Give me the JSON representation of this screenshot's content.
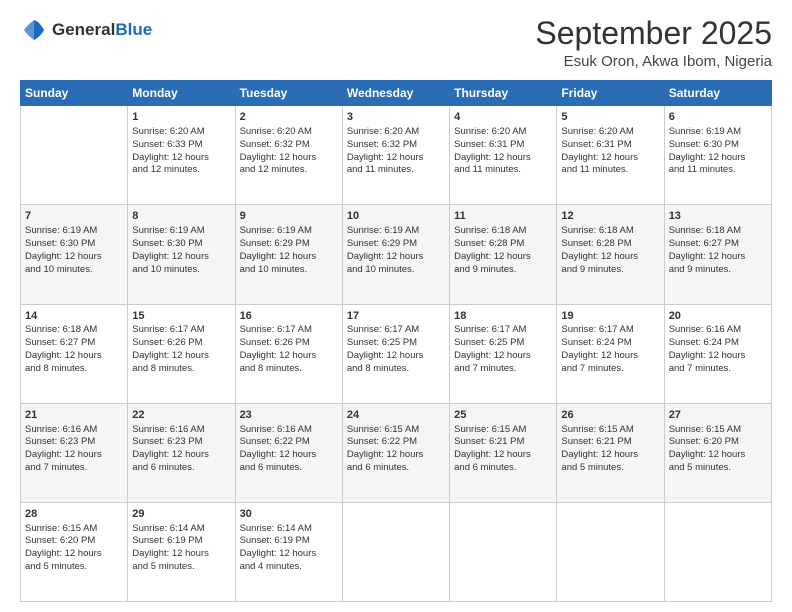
{
  "header": {
    "logo_general": "General",
    "logo_blue": "Blue",
    "month_title": "September 2025",
    "subtitle": "Esuk Oron, Akwa Ibom, Nigeria"
  },
  "days_of_week": [
    "Sunday",
    "Monday",
    "Tuesday",
    "Wednesday",
    "Thursday",
    "Friday",
    "Saturday"
  ],
  "weeks": [
    [
      {
        "day": "",
        "content": ""
      },
      {
        "day": "1",
        "content": "Sunrise: 6:20 AM\nSunset: 6:33 PM\nDaylight: 12 hours\nand 12 minutes."
      },
      {
        "day": "2",
        "content": "Sunrise: 6:20 AM\nSunset: 6:32 PM\nDaylight: 12 hours\nand 12 minutes."
      },
      {
        "day": "3",
        "content": "Sunrise: 6:20 AM\nSunset: 6:32 PM\nDaylight: 12 hours\nand 11 minutes."
      },
      {
        "day": "4",
        "content": "Sunrise: 6:20 AM\nSunset: 6:31 PM\nDaylight: 12 hours\nand 11 minutes."
      },
      {
        "day": "5",
        "content": "Sunrise: 6:20 AM\nSunset: 6:31 PM\nDaylight: 12 hours\nand 11 minutes."
      },
      {
        "day": "6",
        "content": "Sunrise: 6:19 AM\nSunset: 6:30 PM\nDaylight: 12 hours\nand 11 minutes."
      }
    ],
    [
      {
        "day": "7",
        "content": "Sunrise: 6:19 AM\nSunset: 6:30 PM\nDaylight: 12 hours\nand 10 minutes."
      },
      {
        "day": "8",
        "content": "Sunrise: 6:19 AM\nSunset: 6:30 PM\nDaylight: 12 hours\nand 10 minutes."
      },
      {
        "day": "9",
        "content": "Sunrise: 6:19 AM\nSunset: 6:29 PM\nDaylight: 12 hours\nand 10 minutes."
      },
      {
        "day": "10",
        "content": "Sunrise: 6:19 AM\nSunset: 6:29 PM\nDaylight: 12 hours\nand 10 minutes."
      },
      {
        "day": "11",
        "content": "Sunrise: 6:18 AM\nSunset: 6:28 PM\nDaylight: 12 hours\nand 9 minutes."
      },
      {
        "day": "12",
        "content": "Sunrise: 6:18 AM\nSunset: 6:28 PM\nDaylight: 12 hours\nand 9 minutes."
      },
      {
        "day": "13",
        "content": "Sunrise: 6:18 AM\nSunset: 6:27 PM\nDaylight: 12 hours\nand 9 minutes."
      }
    ],
    [
      {
        "day": "14",
        "content": "Sunrise: 6:18 AM\nSunset: 6:27 PM\nDaylight: 12 hours\nand 8 minutes."
      },
      {
        "day": "15",
        "content": "Sunrise: 6:17 AM\nSunset: 6:26 PM\nDaylight: 12 hours\nand 8 minutes."
      },
      {
        "day": "16",
        "content": "Sunrise: 6:17 AM\nSunset: 6:26 PM\nDaylight: 12 hours\nand 8 minutes."
      },
      {
        "day": "17",
        "content": "Sunrise: 6:17 AM\nSunset: 6:25 PM\nDaylight: 12 hours\nand 8 minutes."
      },
      {
        "day": "18",
        "content": "Sunrise: 6:17 AM\nSunset: 6:25 PM\nDaylight: 12 hours\nand 7 minutes."
      },
      {
        "day": "19",
        "content": "Sunrise: 6:17 AM\nSunset: 6:24 PM\nDaylight: 12 hours\nand 7 minutes."
      },
      {
        "day": "20",
        "content": "Sunrise: 6:16 AM\nSunset: 6:24 PM\nDaylight: 12 hours\nand 7 minutes."
      }
    ],
    [
      {
        "day": "21",
        "content": "Sunrise: 6:16 AM\nSunset: 6:23 PM\nDaylight: 12 hours\nand 7 minutes."
      },
      {
        "day": "22",
        "content": "Sunrise: 6:16 AM\nSunset: 6:23 PM\nDaylight: 12 hours\nand 6 minutes."
      },
      {
        "day": "23",
        "content": "Sunrise: 6:16 AM\nSunset: 6:22 PM\nDaylight: 12 hours\nand 6 minutes."
      },
      {
        "day": "24",
        "content": "Sunrise: 6:15 AM\nSunset: 6:22 PM\nDaylight: 12 hours\nand 6 minutes."
      },
      {
        "day": "25",
        "content": "Sunrise: 6:15 AM\nSunset: 6:21 PM\nDaylight: 12 hours\nand 6 minutes."
      },
      {
        "day": "26",
        "content": "Sunrise: 6:15 AM\nSunset: 6:21 PM\nDaylight: 12 hours\nand 5 minutes."
      },
      {
        "day": "27",
        "content": "Sunrise: 6:15 AM\nSunset: 6:20 PM\nDaylight: 12 hours\nand 5 minutes."
      }
    ],
    [
      {
        "day": "28",
        "content": "Sunrise: 6:15 AM\nSunset: 6:20 PM\nDaylight: 12 hours\nand 5 minutes."
      },
      {
        "day": "29",
        "content": "Sunrise: 6:14 AM\nSunset: 6:19 PM\nDaylight: 12 hours\nand 5 minutes."
      },
      {
        "day": "30",
        "content": "Sunrise: 6:14 AM\nSunset: 6:19 PM\nDaylight: 12 hours\nand 4 minutes."
      },
      {
        "day": "",
        "content": ""
      },
      {
        "day": "",
        "content": ""
      },
      {
        "day": "",
        "content": ""
      },
      {
        "day": "",
        "content": ""
      }
    ]
  ]
}
